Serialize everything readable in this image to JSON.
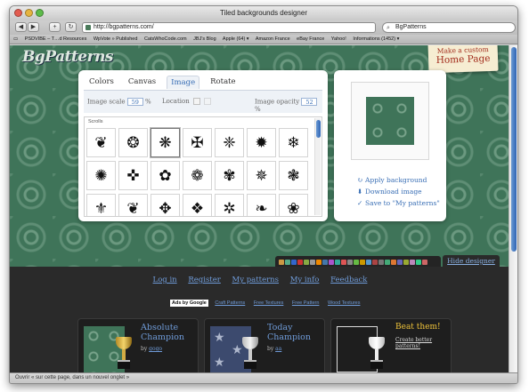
{
  "window": {
    "title": "Tiled backgrounds designer"
  },
  "toolbar": {
    "back": "◀",
    "forward": "▶",
    "add": "+",
    "reload": "↻",
    "url": "http://bgpatterns.com/",
    "search_value": "BgPatterns",
    "search_icon": "search-icon"
  },
  "bookmarks": [
    "PSDVIBE – T…d Resources",
    "WpVote » Published",
    "CatsWhoCode.com",
    "JBJ's Blog",
    "Apple (64) ▾",
    "Amazon France",
    "eBay France",
    "Yahoo!",
    "Informations (1452) ▾"
  ],
  "site": {
    "logo": "BgPatterns",
    "custom_line1": "Make a custom",
    "custom_line2": "Home Page"
  },
  "editor": {
    "tabs": [
      "Colors",
      "Canvas",
      "Image",
      "Rotate"
    ],
    "active_tab": "Image",
    "image_scale_label": "Image scale",
    "image_scale_value": "59",
    "image_scale_unit": "%",
    "location_label": "Location",
    "image_opacity_label": "Image opacity",
    "image_opacity_value": "52",
    "image_opacity_unit": "%",
    "category": "Scrolls",
    "shapes": [
      "❦",
      "❂",
      "❋",
      "✠",
      "❈",
      "✹",
      "❄",
      "✺",
      "✜",
      "✿",
      "❁",
      "✾",
      "✵",
      "❃",
      "⚜",
      "❦",
      "✥",
      "❖",
      "✲",
      "❧",
      "❀"
    ]
  },
  "preview": {
    "apply": "Apply background",
    "download": "Download image",
    "save": "Save to \"My patterns\""
  },
  "strip": {
    "hide": "Hide designer",
    "icon_colors": [
      "#c94",
      "#5a8",
      "#36c",
      "#c33",
      "#8a4",
      "#999",
      "#e80",
      "#47a",
      "#a5c",
      "#3a9",
      "#d55",
      "#888",
      "#6b4",
      "#c90",
      "#59c",
      "#a44",
      "#777",
      "#4a7",
      "#d73",
      "#66b",
      "#9a3",
      "#b8b",
      "#3c8",
      "#c66"
    ]
  },
  "footer": {
    "links": [
      "Log in",
      "Register",
      "My patterns",
      "My info",
      "Feedback"
    ],
    "ads_label": "Ads by Google",
    "ads": [
      "Craft Patterns",
      "Free Textures",
      "Free Pattern",
      "Wood Textures"
    ],
    "cards": [
      {
        "title": "Absolute Champion",
        "by": "by ",
        "user": "gogo"
      },
      {
        "title": "Today Champion",
        "by": "by ",
        "user": "aa"
      }
    ],
    "beat": {
      "title": "Beat them!",
      "cta": "Create better patterns!"
    }
  },
  "status": "Ouvrir « sur cette page, dans un nouvel onglet »",
  "colors": {
    "link": "#6f9bd8",
    "bg_green": "#3f7459",
    "gold": "#f0c43a"
  }
}
